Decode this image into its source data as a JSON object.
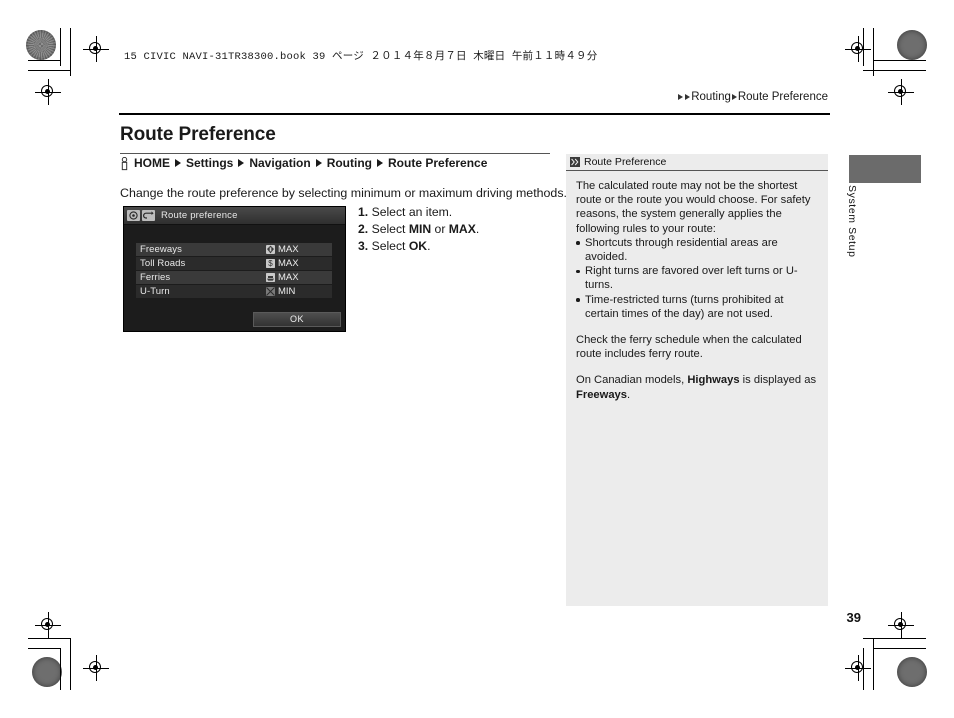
{
  "book_header": "15 CIVIC NAVI-31TR38300.book   39 ページ   ２０１４年８月７日   木曜日   午前１１時４９分",
  "top_breadcrumb": {
    "parent": "Routing",
    "current": "Route Preference"
  },
  "page_title": "Route Preference",
  "breadcrumb": {
    "home_icon": "hand-pointer-icon",
    "items": [
      "HOME",
      "Settings",
      "Navigation",
      "Routing",
      "Route Preference"
    ]
  },
  "intro_text": "Change the route preference by selecting minimum or maximum driving methods.",
  "nav_screen": {
    "title": "Route preference",
    "title_icons": [
      "compass-icon",
      "return-arrow-icon"
    ],
    "rows": [
      {
        "label": "Freeways",
        "icon": "freeway-sign-icon",
        "value": "MAX"
      },
      {
        "label": "Toll Roads",
        "icon": "toll-dollar-icon",
        "value": "MAX"
      },
      {
        "label": "Ferries",
        "icon": "ferry-boat-icon",
        "value": "MAX"
      },
      {
        "label": "U-Turn",
        "icon": "u-turn-prohibited-icon",
        "value": "MIN"
      }
    ],
    "ok_label": "OK"
  },
  "steps": [
    {
      "num": "1.",
      "text": "Select an item."
    },
    {
      "num": "2.",
      "pre": "Select ",
      "b1": "MIN",
      "mid": " or ",
      "b2": "MAX",
      "post": "."
    },
    {
      "num": "3.",
      "pre": "Select ",
      "b1": "OK",
      "post": "."
    }
  ],
  "note": {
    "badge_icon": "note-marker-icon",
    "heading": "Route Preference",
    "p1": "The calculated route may not be the shortest route or the route you would choose. For safety reasons, the system generally applies the following rules to your route:",
    "bullets": [
      "Shortcuts through residential areas are avoided.",
      "Right turns are favored over left turns or U-turns.",
      "Time-restricted turns (turns prohibited at certain times of the day) are not used."
    ],
    "p2": "Check the ferry schedule when the calculated route includes ferry route.",
    "p3_pre": "On Canadian models, ",
    "p3_b1": "Highways",
    "p3_mid": " is displayed as ",
    "p3_b2": "Freeways",
    "p3_post": "."
  },
  "side_tab_label": "System Setup",
  "page_number": "39",
  "colors": {
    "note_panel_bg": "#ececec",
    "side_tab": "#6b6b6b",
    "nav_screen_bg": "#1c1c1c"
  }
}
